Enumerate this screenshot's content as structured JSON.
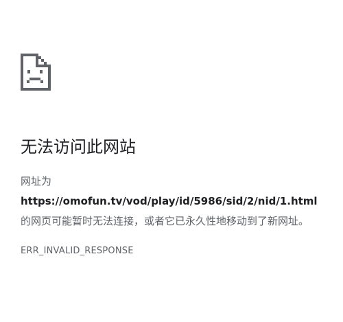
{
  "icon": "sad-page-icon",
  "title": "无法访问此网站",
  "message": {
    "prefix": "网址为",
    "url": "https://omofun.tv/vod/play/id/5986/sid/2/nid/1.html",
    "suffix": "的网页可能暂时无法连接，或者它已永久性地移动到了新网址。"
  },
  "error_code": "ERR_INVALID_RESPONSE",
  "colors": {
    "icon": "#5f6368",
    "title": "#202124",
    "text": "#5f6368"
  }
}
